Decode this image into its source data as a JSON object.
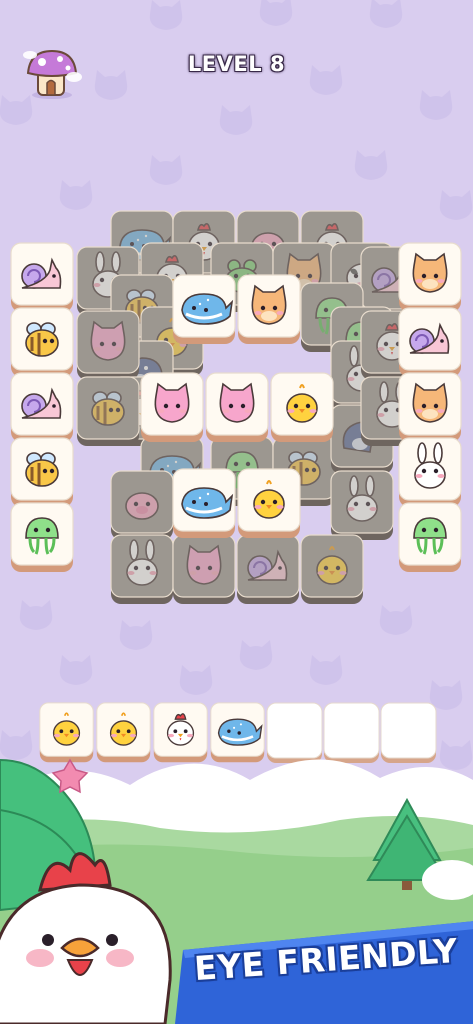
{
  "hud": {
    "level_label": "LEVEL 8"
  },
  "colors": {
    "background": "#d9cdef",
    "cat_silhouette": "#cdbfe8",
    "tile_face": "#fffaf2",
    "tile_side": "#c98f72",
    "tile_shade": "#6e6660",
    "banner": "#2f64d8"
  },
  "board": {
    "left_column": [
      "snail",
      "bee",
      "snail",
      "bee",
      "jellyfish"
    ],
    "right_column": [
      "cat",
      "snail",
      "cat",
      "bunny",
      "jellyfish"
    ],
    "top_exposed": [
      "whale",
      "cat"
    ],
    "middle_exposed": [
      "pink-cat",
      "pink-cat",
      "chick"
    ],
    "lower_exposed": [
      "whale",
      "chick"
    ],
    "covered_visible": [
      "whale",
      "chicken",
      "pig",
      "chicken",
      "chicken",
      "frog",
      "cat",
      "cow",
      "bunny",
      "snail",
      "bee",
      "chick",
      "jellyfish",
      "jellyfish",
      "dolphin",
      "bunny",
      "pink-cat",
      "chicken",
      "chicken",
      "whale",
      "jellyfish",
      "bee",
      "dolphin",
      "pig",
      "bunny",
      "bee",
      "bunny",
      "bunny",
      "pink-cat",
      "snail",
      "chick"
    ]
  },
  "tray": {
    "slots_total": 7,
    "filled": [
      "chick",
      "chick",
      "chicken",
      "whale"
    ]
  },
  "promo": {
    "banner_text": "EYE FRIENDLY"
  }
}
